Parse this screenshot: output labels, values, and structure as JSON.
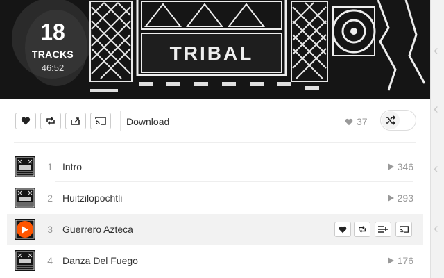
{
  "playlist": {
    "track_count": "18",
    "track_count_label": "TRACKS",
    "duration": "46:52",
    "artwork_text": "TRIBAL"
  },
  "toolbar": {
    "download_label": "Download",
    "likes_count": "37"
  },
  "tracks": [
    {
      "number": "1",
      "title": "Intro",
      "plays": "346"
    },
    {
      "number": "2",
      "title": "Huitzilopochtli",
      "plays": "293"
    },
    {
      "number": "3",
      "title": "Guerrero Azteca",
      "plays": ""
    },
    {
      "number": "4",
      "title": "Danza Del Fuego",
      "plays": "176"
    }
  ],
  "colors": {
    "accent": "#ff5500",
    "text": "#333333",
    "muted": "#999999",
    "hover_row": "#f2f2f2"
  }
}
